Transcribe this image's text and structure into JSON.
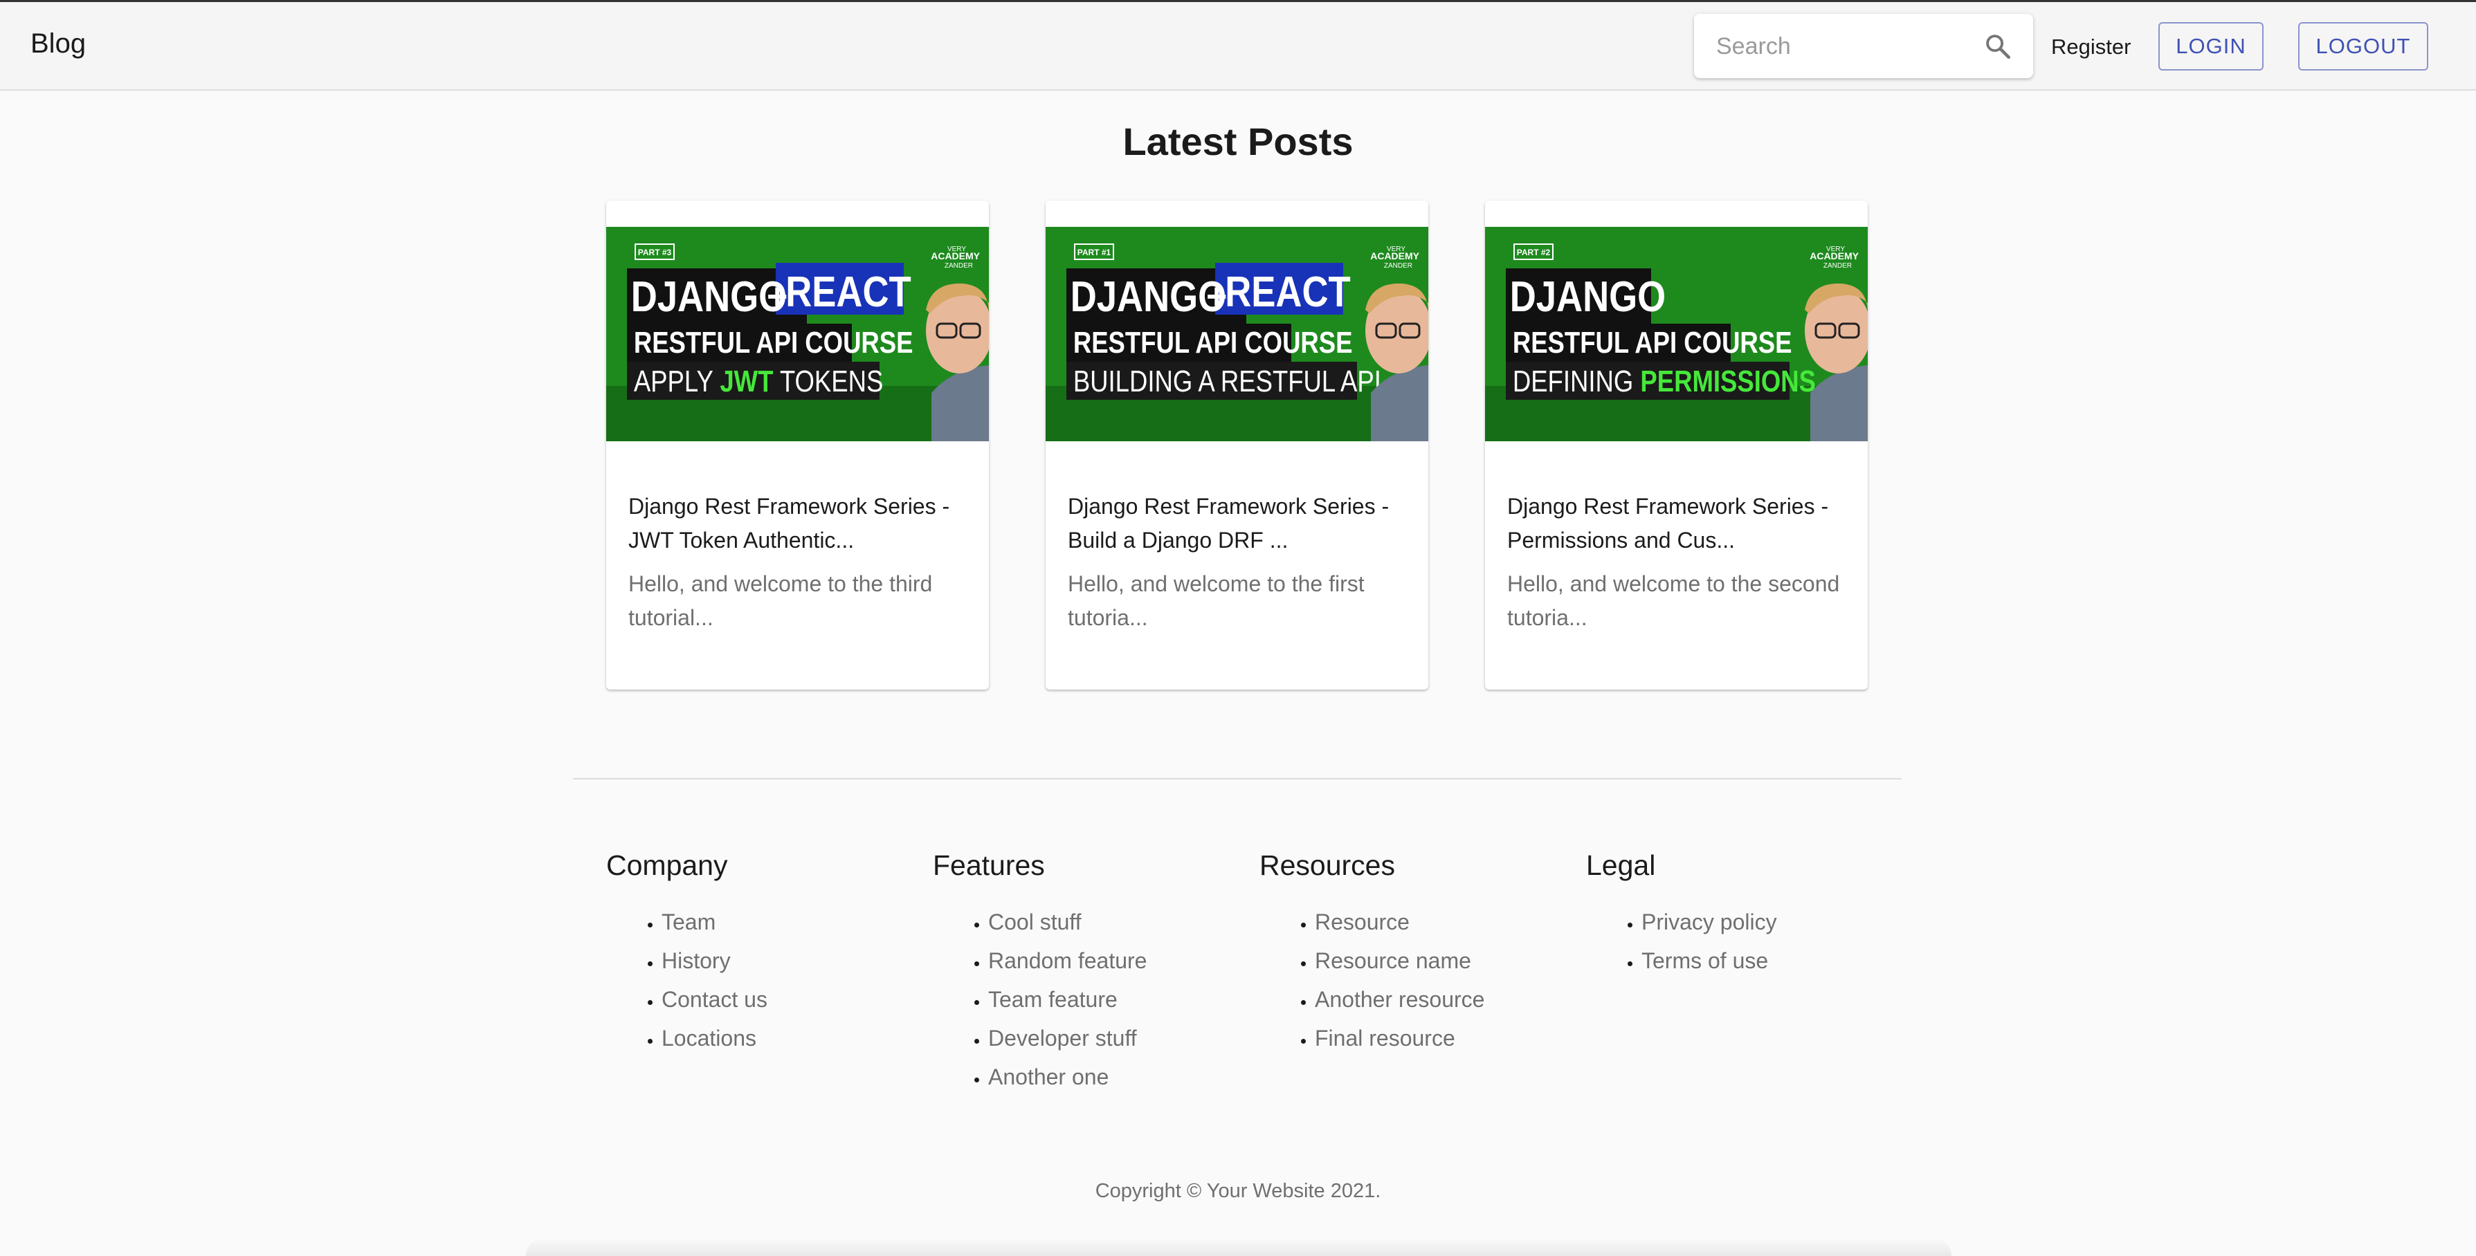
{
  "header": {
    "brand": "Blog",
    "search_placeholder": "Search",
    "register_label": "Register",
    "login_label": "LOGIN",
    "logout_label": "LOGOUT"
  },
  "main": {
    "heading": "Latest Posts",
    "posts": [
      {
        "thumb": {
          "badge": "PART #3",
          "line1": "DJANGO",
          "plus": "+",
          "react": "REACT",
          "line2": "RESTFUL API COURSE",
          "line3a": "APPLY ",
          "line3b": "JWT",
          "line3c": " TOKENS",
          "logo1": "VERY",
          "logo2": "ACADEMY",
          "logo3": "ZANDER"
        },
        "title": "Django Rest Framework Series - JWT Token Authentic...",
        "excerpt": "Hello, and welcome to the third tutorial..."
      },
      {
        "thumb": {
          "badge": "PART #1",
          "line1": "DJANGO",
          "plus": "+",
          "react": "REACT",
          "line2": "RESTFUL API COURSE",
          "line3a": "BUILDING A RESTFUL API",
          "line3b": "",
          "line3c": "",
          "logo1": "VERY",
          "logo2": "ACADEMY",
          "logo3": "ZANDER"
        },
        "title": "Django Rest Framework Series - Build a Django DRF ...",
        "excerpt": "Hello, and welcome to the first tutoria..."
      },
      {
        "thumb": {
          "badge": "PART #2",
          "line1": "DJANGO",
          "plus": "",
          "react": "",
          "line2": "RESTFUL API COURSE",
          "line3a": "DEFINING ",
          "line3b": "PERMISSIONS",
          "line3c": "",
          "logo1": "VERY",
          "logo2": "ACADEMY",
          "logo3": "ZANDER"
        },
        "title": "Django Rest Framework Series - Permissions and Cus...",
        "excerpt": "Hello, and welcome to the second tutoria..."
      }
    ]
  },
  "footer": {
    "columns": [
      {
        "title": "Company",
        "items": [
          "Team",
          "History",
          "Contact us",
          "Locations"
        ]
      },
      {
        "title": "Features",
        "items": [
          "Cool stuff",
          "Random feature",
          "Team feature",
          "Developer stuff",
          "Another one"
        ]
      },
      {
        "title": "Resources",
        "items": [
          "Resource",
          "Resource name",
          "Another resource",
          "Final resource"
        ]
      },
      {
        "title": "Legal",
        "items": [
          "Privacy policy",
          "Terms of use"
        ]
      }
    ],
    "copyright": "Copyright © Your Website 2021."
  },
  "colors": {
    "primary": "#3f51b5",
    "thumb_green": "#1e8a1e",
    "thumb_blue": "#1833b8",
    "jwt_green": "#46e83a"
  }
}
